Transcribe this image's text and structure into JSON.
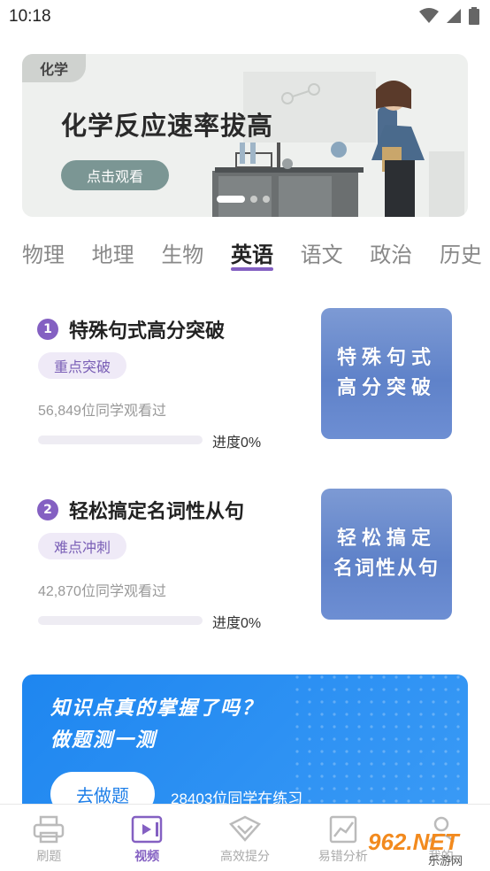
{
  "status_bar": {
    "time": "10:18"
  },
  "banner": {
    "tag": "化学",
    "title": "化学反应速率拔高",
    "button": "点击观看"
  },
  "subjects": [
    "物理",
    "地理",
    "生物",
    "英语",
    "语文",
    "政治",
    "历史"
  ],
  "active_subject": "英语",
  "courses": [
    {
      "num": "1",
      "title": "特殊句式高分突破",
      "tag": "重点突破",
      "views": "56,849位同学观看过",
      "progress": 0,
      "progress_text": "进度0%",
      "thumb_line1": "特殊句式",
      "thumb_line2": "高分突破"
    },
    {
      "num": "2",
      "title": "轻松搞定名词性从句",
      "tag": "难点冲刺",
      "views": "42,870位同学观看过",
      "progress": 0,
      "progress_text": "进度0%",
      "thumb_line1": "轻松搞定",
      "thumb_line2": "名词性从句"
    }
  ],
  "practice": {
    "line1": "知识点真的掌握了吗？",
    "line2": "做题测一测",
    "button": "去做题",
    "count": "28403位同学在练习"
  },
  "bottom_nav": [
    {
      "label": "刷题",
      "icon": "printer-icon"
    },
    {
      "label": "视频",
      "icon": "video-icon"
    },
    {
      "label": "高效提分",
      "icon": "chevron-down-icon"
    },
    {
      "label": "易错分析",
      "icon": "chart-icon"
    },
    {
      "label": "我的",
      "icon": "user-icon"
    }
  ],
  "watermark": {
    "text": "962.NET",
    "sub": "乐游网"
  },
  "colors": {
    "accent": "#8460c2",
    "practice_blue": "#1e86f0",
    "banner_button": "#7b9694"
  }
}
